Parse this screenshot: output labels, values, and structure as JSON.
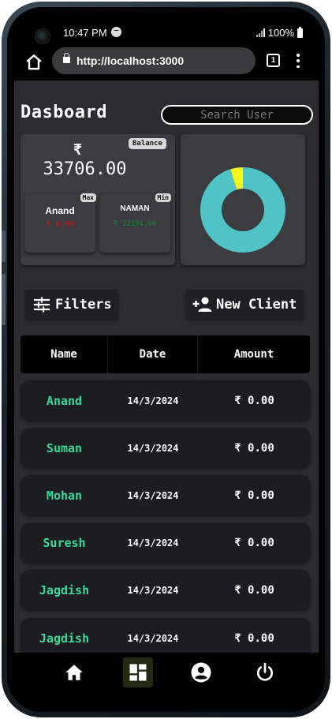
{
  "status_bar": {
    "time": "10:47 PM",
    "battery": "100%"
  },
  "browser": {
    "url": "http://localhost:3000",
    "tab_count": "1"
  },
  "page": {
    "title": "Dasboard",
    "search_placeholder": "Search User"
  },
  "balance_card": {
    "badge": "Balance",
    "currency_symbol": "₹",
    "amount": "33706.00",
    "max": {
      "badge": "Max",
      "name": "Anand",
      "value": "₹ 0.00",
      "color": "#d11a1a"
    },
    "min": {
      "badge": "Min",
      "name": "NAMAN",
      "value": "₹ 32104.00",
      "color": "#1a8a2e"
    }
  },
  "chart_data": {
    "type": "pie",
    "donut": true,
    "values": [
      32104,
      1602
    ],
    "colors": [
      "#4fc3c6",
      "#f5f51a"
    ]
  },
  "actions": {
    "filters_label": "Filters",
    "new_client_label": "New Client"
  },
  "table": {
    "headers": [
      "Name",
      "Date",
      "Amount"
    ],
    "rows": [
      {
        "name": "Anand",
        "date": "14/3/2024",
        "amount": "₹ 0.00"
      },
      {
        "name": "Suman",
        "date": "14/3/2024",
        "amount": "₹ 0.00"
      },
      {
        "name": "Mohan",
        "date": "14/3/2024",
        "amount": "₹ 0.00"
      },
      {
        "name": "Suresh",
        "date": "14/3/2024",
        "amount": "₹ 0.00"
      },
      {
        "name": "Jagdish",
        "date": "14/3/2024",
        "amount": "₹ 0.00"
      },
      {
        "name": "Jagdish",
        "date": "14/3/2024",
        "amount": "₹ 0.00"
      }
    ]
  },
  "bottom_nav": {
    "items": [
      {
        "icon": "home-icon",
        "active": false
      },
      {
        "icon": "dashboard-icon",
        "active": true
      },
      {
        "icon": "account-circle-icon",
        "active": false
      },
      {
        "icon": "power-icon",
        "active": false
      }
    ]
  },
  "colors": {
    "accent_green": "#37d99b",
    "background": "#2a2c30"
  }
}
